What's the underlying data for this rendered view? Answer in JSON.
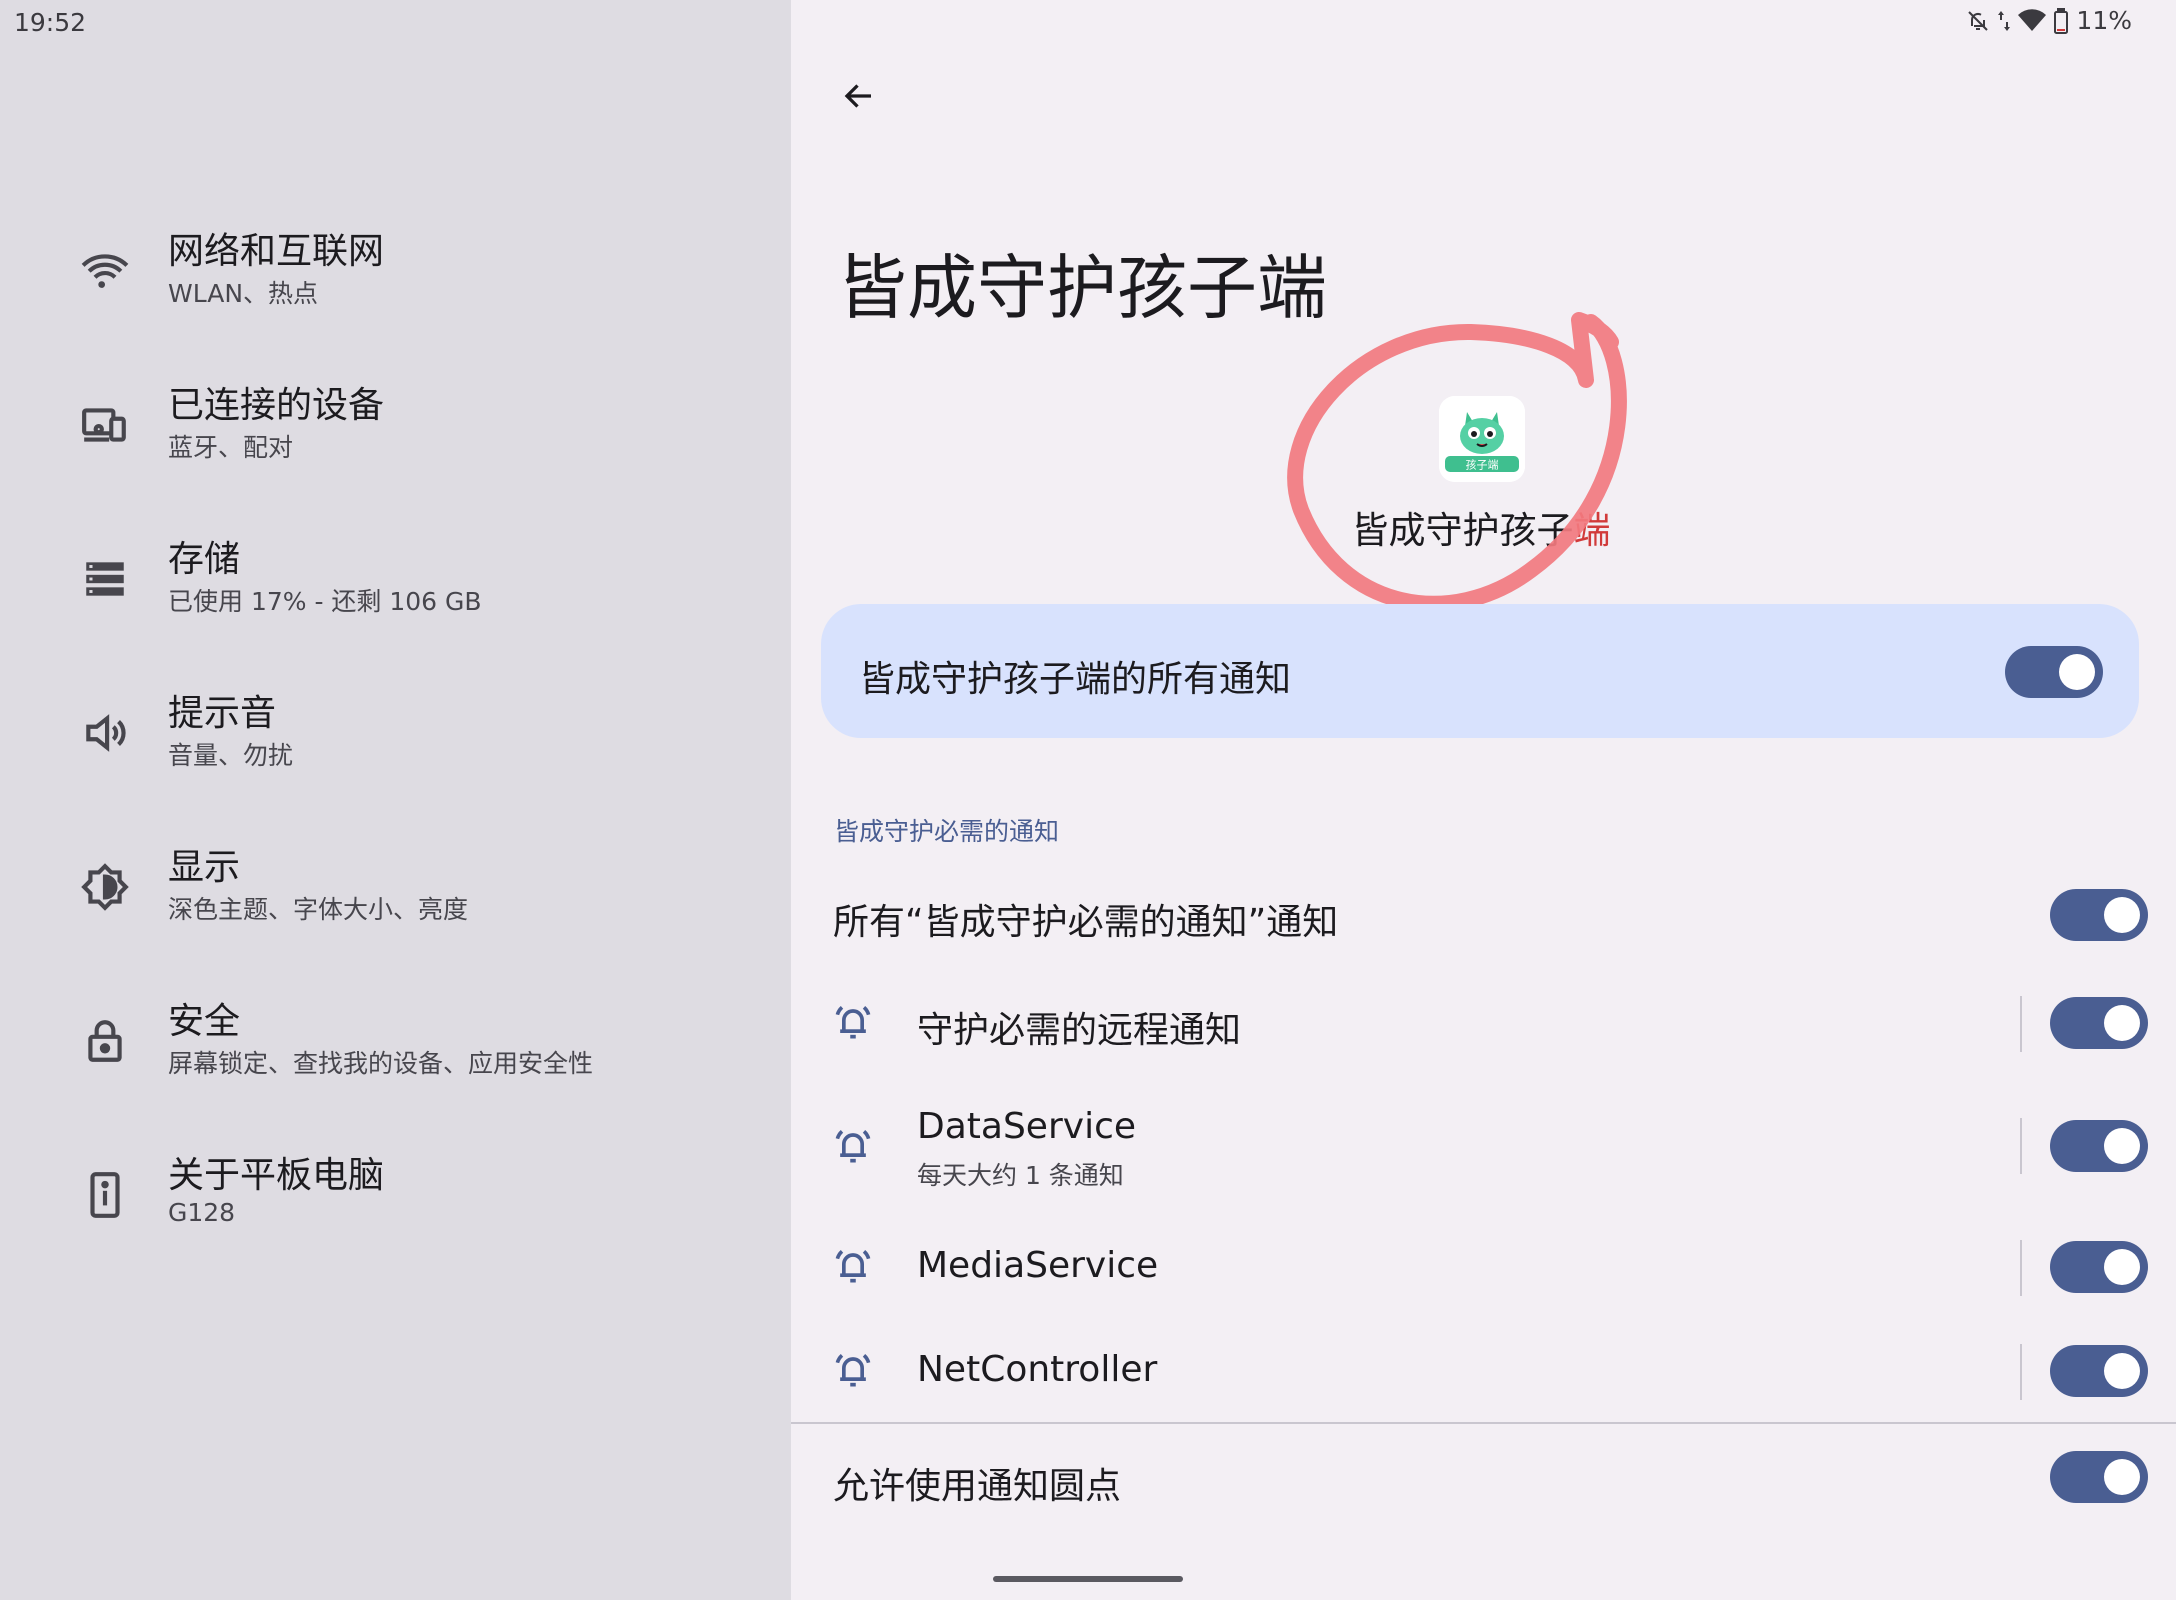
{
  "status_bar": {
    "time": "19:52",
    "battery": "11%",
    "icons": [
      "bell-off-icon",
      "data-arrows-icon",
      "wifi-icon",
      "battery-icon"
    ]
  },
  "sidebar": {
    "items": [
      {
        "title": "网络和互联网",
        "subtitle": "WLAN、热点",
        "icon": "wifi-icon"
      },
      {
        "title": "已连接的设备",
        "subtitle": "蓝牙、配对",
        "icon": "devices-icon"
      },
      {
        "title": "存储",
        "subtitle": "已使用 17% - 还剩 106 GB",
        "icon": "storage-icon"
      },
      {
        "title": "提示音",
        "subtitle": "音量、勿扰",
        "icon": "volume-icon"
      },
      {
        "title": "显示",
        "subtitle": "深色主题、字体大小、亮度",
        "icon": "brightness-icon"
      },
      {
        "title": "安全",
        "subtitle": "屏幕锁定、查找我的设备、应用安全性",
        "icon": "lock-icon"
      },
      {
        "title": "关于平板电脑",
        "subtitle": "G128",
        "icon": "tablet-info-icon"
      }
    ]
  },
  "header": {
    "back_icon": "arrow-back-icon",
    "title": "皆成守护孩子端"
  },
  "app_info": {
    "name_main": "皆成守护孩子",
    "name_last": "端",
    "icon_badge": "孩子端",
    "accent_green": "#3fbf8f",
    "annotation_color": "#f27a7f"
  },
  "all_notifications": {
    "label": "皆成守护孩子端的所有通知",
    "enabled": true
  },
  "section": {
    "label": "皆成守护必需的通知",
    "rows": [
      {
        "label": "所有“皆成守护必需的通知”通知",
        "enabled": true
      },
      {
        "label": "守护必需的远程通知",
        "enabled": true,
        "icon": "bell-ring-icon"
      },
      {
        "label": "DataService",
        "subtitle": "每天大约 1 条通知",
        "enabled": true,
        "icon": "bell-ring-icon"
      },
      {
        "label": "MediaService",
        "enabled": true,
        "icon": "bell-ring-icon"
      },
      {
        "label": "NetController",
        "enabled": true,
        "icon": "bell-ring-icon"
      }
    ]
  },
  "dots": {
    "label": "允许使用通知圆点",
    "enabled": true
  },
  "colors": {
    "toggle_on": "#4a5e92",
    "card_bg": "#d8e2fd",
    "sidebar_bg": "#dedce2",
    "section_accent": "#4a5e92"
  }
}
